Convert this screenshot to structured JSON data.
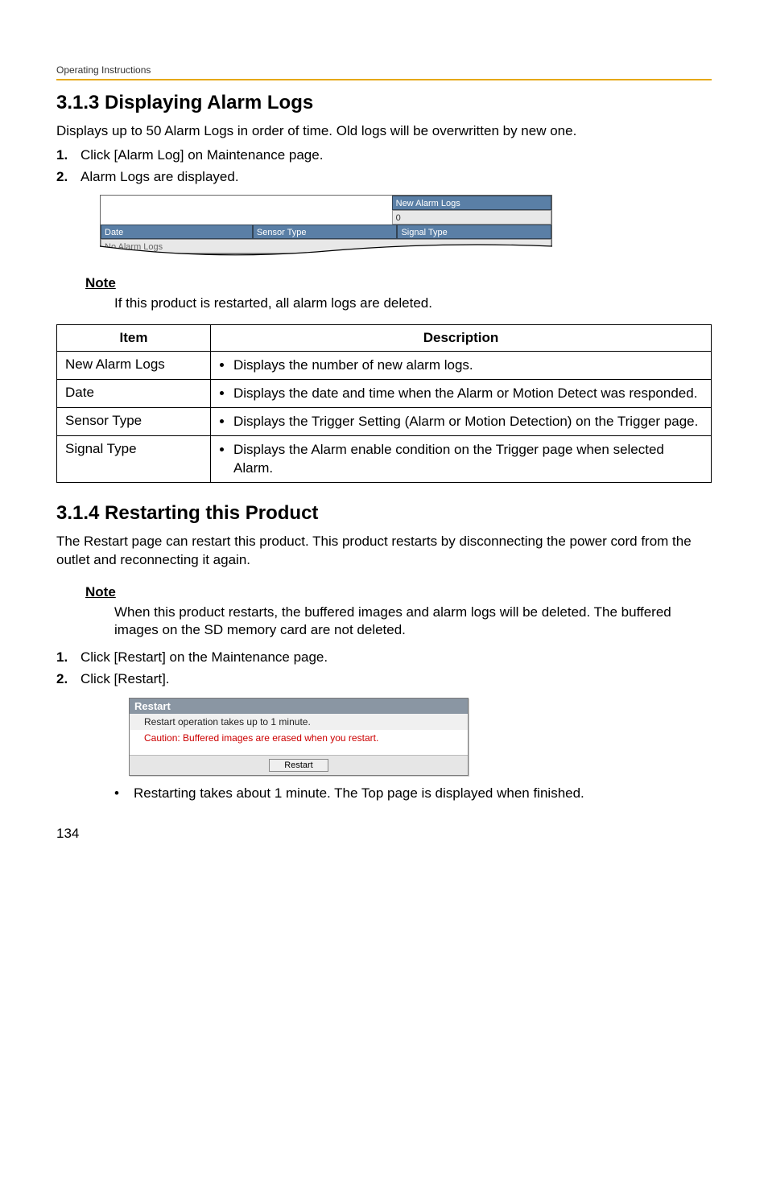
{
  "header": {
    "running": "Operating Instructions"
  },
  "section313": {
    "title": "3.1.3    Displaying Alarm Logs",
    "intro": "Displays up to 50 Alarm Logs in order of time. Old logs will be overwritten by new one.",
    "steps": [
      "Click [Alarm Log] on Maintenance page.",
      "Alarm Logs are displayed."
    ],
    "alarm_illus": {
      "new_alarm_logs_label": "New Alarm Logs",
      "new_alarm_logs_value": "0",
      "date_label": "Date",
      "sensor_type_label": "Sensor Type",
      "signal_type_label": "Signal Type",
      "no_alarm": "No Alarm Logs"
    },
    "note_heading": "Note",
    "note_body": "If this product is restarted, all alarm logs are deleted.",
    "table": {
      "headers": {
        "item": "Item",
        "desc": "Description"
      },
      "rows": [
        {
          "item": "New Alarm Logs",
          "desc": "Displays the number of new alarm logs."
        },
        {
          "item": "Date",
          "desc": "Displays the date and time when the Alarm or Motion Detect was responded."
        },
        {
          "item": "Sensor Type",
          "desc": "Displays the Trigger Setting (Alarm or Motion Detection) on the Trigger page."
        },
        {
          "item": "Signal Type",
          "desc": "Displays the Alarm enable condition on the Trigger page when selected Alarm."
        }
      ]
    }
  },
  "section314": {
    "title": "3.1.4    Restarting this Product",
    "intro": "The Restart page can restart this product. This product restarts by disconnecting the power cord from the outlet and reconnecting it again.",
    "note_heading": "Note",
    "note_body": "When this product restarts, the buffered images and alarm logs will be deleted. The buffered images on the SD memory card are not deleted.",
    "steps": [
      "Click [Restart] on the Maintenance page.",
      "Click [Restart]."
    ],
    "dialog": {
      "title": "Restart",
      "msg1": "Restart operation takes up to 1 minute.",
      "msg2": "Caution: Buffered images are erased when you restart.",
      "button": "Restart"
    },
    "after_bullet": "Restarting takes about 1 minute. The Top page is displayed when finished."
  },
  "page_number": "134"
}
